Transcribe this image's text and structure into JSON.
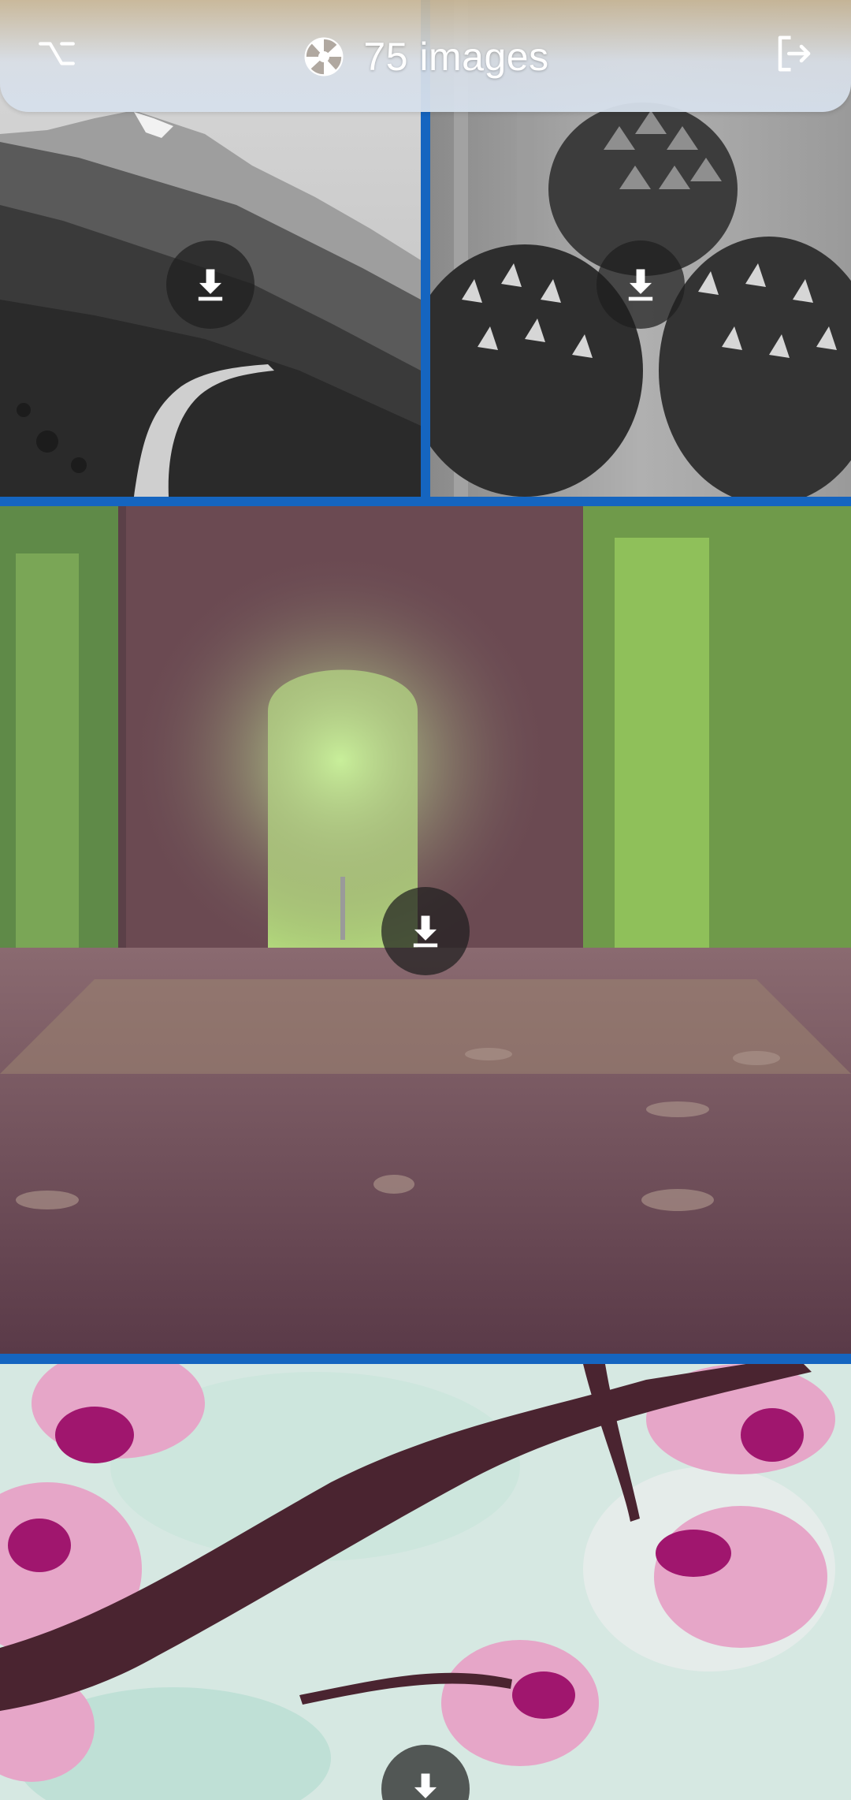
{
  "app": {
    "title": "75 images"
  },
  "toolbar": {
    "left_icon": "option-key-icon",
    "center_icon": "camera-aperture-icon",
    "right_icon": "logout-icon"
  },
  "colors": {
    "grid_gap": "#1565c0",
    "toolbar_text": "#ffffff",
    "download_button_bg": "#1e1e1e"
  },
  "gallery": {
    "tiles": [
      {
        "subject": "mountain-trail-bw",
        "action_icon": "download-icon"
      },
      {
        "subject": "pine-cones-bw",
        "action_icon": "download-icon"
      },
      {
        "subject": "forest-tunnel",
        "action_icon": "download-icon"
      },
      {
        "subject": "cherry-blossom-branch",
        "action_icon": "download-icon"
      }
    ]
  }
}
